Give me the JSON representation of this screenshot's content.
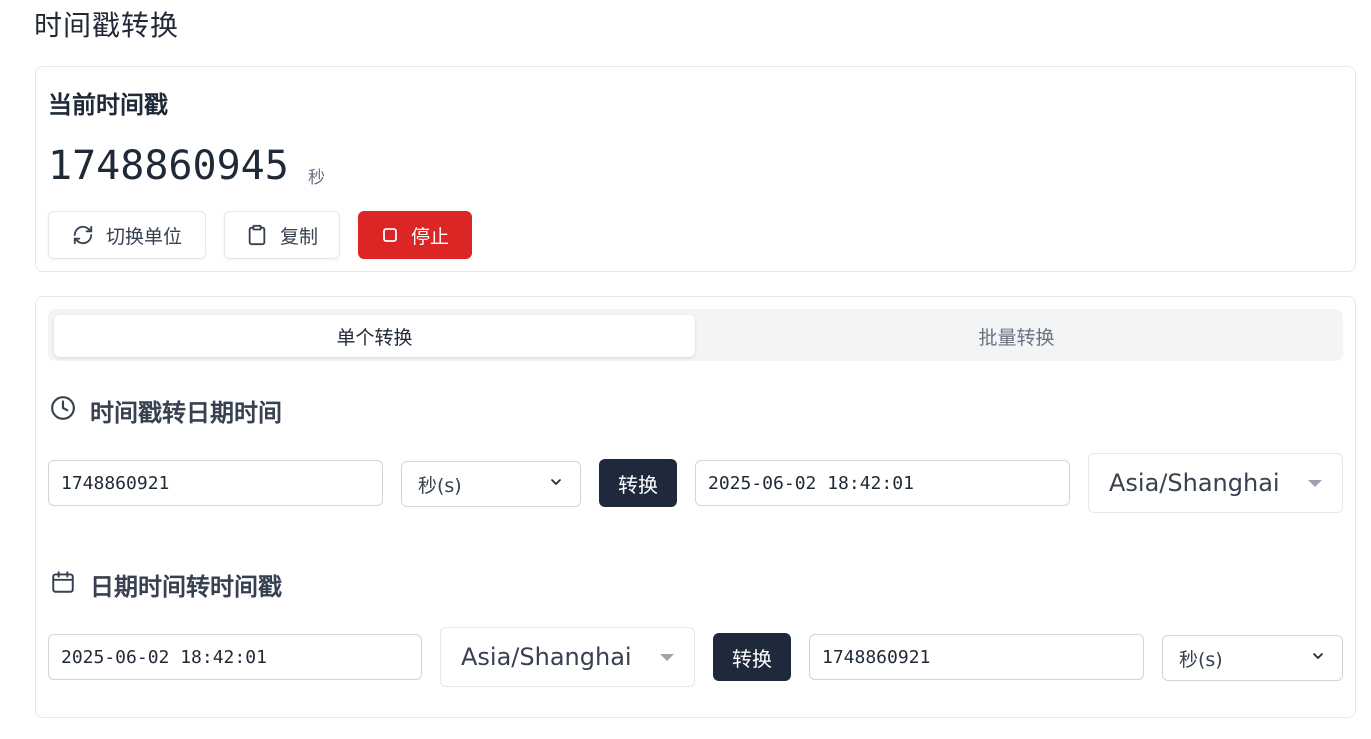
{
  "page": {
    "title": "时间戳转换"
  },
  "current": {
    "title": "当前时间戳",
    "value": "1748860945",
    "unit": "秒",
    "buttons": {
      "toggle_unit": "切换单位",
      "copy": "复制",
      "stop": "停止"
    },
    "colors": {
      "stop": "#dc2626"
    }
  },
  "tabs": [
    {
      "label": "单个转换",
      "active": true
    },
    {
      "label": "批量转换",
      "active": false
    }
  ],
  "ts_to_date": {
    "heading": "时间戳转日期时间",
    "input_value": "1748860921",
    "unit_select": "秒(s)",
    "convert_label": "转换",
    "output_value": "2025-06-02 18:42:01",
    "timezone": "Asia/Shanghai"
  },
  "date_to_ts": {
    "heading": "日期时间转时间戳",
    "input_value": "2025-06-02 18:42:01",
    "timezone": "Asia/Shanghai",
    "convert_label": "转换",
    "output_value": "1748860921",
    "unit_select": "秒(s)"
  },
  "icons": {
    "toggle_unit": "refresh-icon",
    "copy": "clipboard-icon",
    "stop": "stop-square-icon",
    "ts_to_date": "clock-icon",
    "date_to_ts": "calendar-icon"
  }
}
